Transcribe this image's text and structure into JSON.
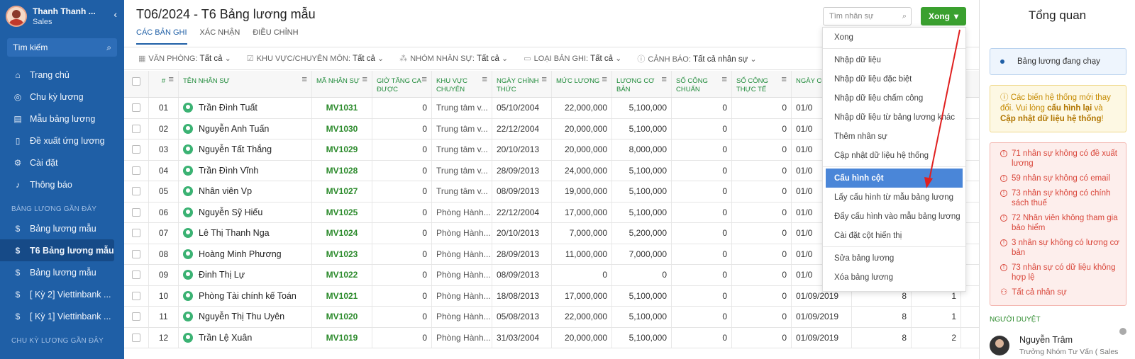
{
  "sidebar": {
    "user_name": "Thanh Thanh ...",
    "user_role": "Sales",
    "search_label": "Tìm kiếm",
    "items": [
      {
        "label": "Trang chủ",
        "icon": "home"
      },
      {
        "label": "Chu kỳ lương",
        "icon": "cycle"
      },
      {
        "label": "Mẫu bảng lương",
        "icon": "template"
      },
      {
        "label": "Đề xuất ứng lương",
        "icon": "document"
      },
      {
        "label": "Cài đặt",
        "icon": "gear"
      },
      {
        "label": "Thông báo",
        "icon": "bell"
      }
    ],
    "recent_section": "BẢNG LƯƠNG GẦN ĐÂY",
    "recent": [
      {
        "label": "Bảng lương mẫu"
      },
      {
        "label": "T6 Bảng lương mẫu"
      },
      {
        "label": "Bảng lương mẫu"
      },
      {
        "label": "[ Kỳ 2] Viettinbank ..."
      },
      {
        "label": "[ Kỳ 1] Viettinbank ..."
      }
    ],
    "cycle_section": "CHU KỲ LƯƠNG GẦN ĐÂY"
  },
  "main": {
    "title": "T06/2024 - T6 Bảng lương mẫu",
    "tabs": [
      "CÁC BẢN GHI",
      "XÁC NHẬN",
      "ĐIỀU CHỈNH"
    ],
    "search_placeholder": "Tìm nhân sự",
    "done_button": "Xong",
    "filters": [
      {
        "label": "VĂN PHÒNG:",
        "value": "Tất cả"
      },
      {
        "label": "KHU VỰC/CHUYÊN MÔN:",
        "value": "Tất cả"
      },
      {
        "label": "NHÓM NHÂN SỰ:",
        "value": "Tất cả"
      },
      {
        "label": "LOẠI BẢN GHI:",
        "value": "Tất cả"
      },
      {
        "label": "CẢNH BÁO:",
        "value": "Tất cả nhân sự"
      }
    ],
    "columns": [
      "#",
      "TÊN NHÂN SỰ",
      "MÃ NHÂN SỰ",
      "GIỜ TĂNG CA ĐƯỢC",
      "KHU VỰC CHUYÊN",
      "NGÀY CHÍNH THỨC",
      "MỨC LƯƠNG",
      "LƯƠNG CƠ BẢN",
      "SỐ CÔNG CHUẨN",
      "SỐ CÔNG THỰC TẾ",
      "NGÀY CON"
    ],
    "rows": [
      {
        "num": "01",
        "name": "Trần Đình Tuất",
        "code": "MV1031",
        "ot": "0",
        "area": "Trung tâm v...",
        "date": "05/10/2004",
        "salary": "22,000,000",
        "base": "5,100,000",
        "std": "0",
        "actual": "0",
        "ngay": "01/0",
        "x1": "",
        "x2": ""
      },
      {
        "num": "02",
        "name": "Nguyễn Anh Tuấn",
        "code": "MV1030",
        "ot": "0",
        "area": "Trung tâm v...",
        "date": "22/12/2004",
        "salary": "20,000,000",
        "base": "5,100,000",
        "std": "0",
        "actual": "0",
        "ngay": "01/0",
        "x1": "",
        "x2": ""
      },
      {
        "num": "03",
        "name": "Nguyễn Tất Thắng",
        "code": "MV1029",
        "ot": "0",
        "area": "Trung tâm v...",
        "date": "20/10/2013",
        "salary": "20,000,000",
        "base": "8,000,000",
        "std": "0",
        "actual": "0",
        "ngay": "01/0",
        "x1": "",
        "x2": ""
      },
      {
        "num": "04",
        "name": "Trần Đình Vĩnh",
        "code": "MV1028",
        "ot": "0",
        "area": "Trung tâm v...",
        "date": "28/09/2013",
        "salary": "24,000,000",
        "base": "5,100,000",
        "std": "0",
        "actual": "0",
        "ngay": "01/0",
        "x1": "",
        "x2": ""
      },
      {
        "num": "05",
        "name": "Nhân viên Vp",
        "code": "MV1027",
        "ot": "0",
        "area": "Trung tâm v...",
        "date": "08/09/2013",
        "salary": "19,000,000",
        "base": "5,100,000",
        "std": "0",
        "actual": "0",
        "ngay": "01/0",
        "x1": "",
        "x2": ""
      },
      {
        "num": "06",
        "name": "Nguyễn Sỹ Hiếu",
        "code": "MV1025",
        "ot": "0",
        "area": "Phòng Hành...",
        "date": "22/12/2004",
        "salary": "17,000,000",
        "base": "5,100,000",
        "std": "0",
        "actual": "0",
        "ngay": "01/0",
        "x1": "",
        "x2": ""
      },
      {
        "num": "07",
        "name": "Lê Thị Thanh Nga",
        "code": "MV1024",
        "ot": "0",
        "area": "Phòng Hành...",
        "date": "20/10/2013",
        "salary": "7,000,000",
        "base": "5,200,000",
        "std": "0",
        "actual": "0",
        "ngay": "01/0",
        "x1": "",
        "x2": ""
      },
      {
        "num": "08",
        "name": "Hoàng Minh Phương",
        "code": "MV1023",
        "ot": "0",
        "area": "Phòng Hành...",
        "date": "28/09/2013",
        "salary": "11,000,000",
        "base": "7,000,000",
        "std": "0",
        "actual": "0",
        "ngay": "01/0",
        "x1": "",
        "x2": ""
      },
      {
        "num": "09",
        "name": "Đinh Thị Lự",
        "code": "MV1022",
        "ot": "0",
        "area": "Phòng Hành...",
        "date": "08/09/2013",
        "salary": "0",
        "base": "0",
        "std": "0",
        "actual": "0",
        "ngay": "01/0",
        "x1": "",
        "x2": ""
      },
      {
        "num": "10",
        "name": "Phòng Tài chính kế Toán",
        "code": "MV1021",
        "ot": "0",
        "area": "Phòng Hành...",
        "date": "18/08/2013",
        "salary": "17,000,000",
        "base": "5,100,000",
        "std": "0",
        "actual": "0",
        "ngay": "01/09/2019",
        "x1": "8",
        "x2": "1"
      },
      {
        "num": "11",
        "name": "Nguyễn Thị Thu Uyên",
        "code": "MV1020",
        "ot": "0",
        "area": "Phòng Hành...",
        "date": "05/08/2013",
        "salary": "22,000,000",
        "base": "5,100,000",
        "std": "0",
        "actual": "0",
        "ngay": "01/09/2019",
        "x1": "8",
        "x2": "1"
      },
      {
        "num": "12",
        "name": "Trần Lệ Xuân",
        "code": "MV1019",
        "ot": "0",
        "area": "Phòng Hành...",
        "date": "31/03/2004",
        "salary": "20,000,000",
        "base": "5,100,000",
        "std": "0",
        "actual": "0",
        "ngay": "01/09/2019",
        "x1": "8",
        "x2": "2"
      }
    ]
  },
  "menu": {
    "items": [
      "Xong",
      "Nhập dữ liệu",
      "Nhập dữ liệu đặc biệt",
      "Nhập dữ liệu chấm công",
      "Nhập dữ liệu từ bảng lương khác",
      "Thêm nhân sự",
      "Cập nhật dữ liệu hệ thống",
      "Cấu hình cột",
      "Lấy cấu hình từ mẫu bảng lương",
      "Đẩy cấu hình vào mẫu bảng lương",
      "Cài đặt cột hiển thị",
      "Sửa bảng lương",
      "Xóa bảng lương"
    ],
    "selected": "Cấu hình cột"
  },
  "right_panel": {
    "title": "Tổng quan",
    "status": "Bảng lương đang chạy",
    "notice_pre": "Các biến hệ thống mới thay đổi. Vui lòng ",
    "notice_link1": "cấu hình lại",
    "notice_mid": " và ",
    "notice_link2": "Cập nhật dữ liệu hệ thống",
    "notice_post": "!",
    "warnings": [
      "71 nhân sự không có đề xuất lương",
      "59 nhân sự không có email",
      "73 nhân sự không có chính sách thuế",
      "72 Nhân viên không tham gia bảo hiểm",
      "3 nhân sự không có lương cơ bản",
      "73 nhân sự có dữ liệu không hợp lệ"
    ],
    "all_staff": "Tất cả nhân sự",
    "approver_header": "NGƯỜI DUYỆT",
    "approver_name": "Nguyễn Trâm",
    "approver_role": "Trưởng Nhóm Tư Vấn ( Sales"
  },
  "colors": {
    "sidebar": "#1f5fa6",
    "accent_green": "#3aa02f",
    "warning_red": "#d9473b",
    "notice_yellow": "#c58a00"
  }
}
